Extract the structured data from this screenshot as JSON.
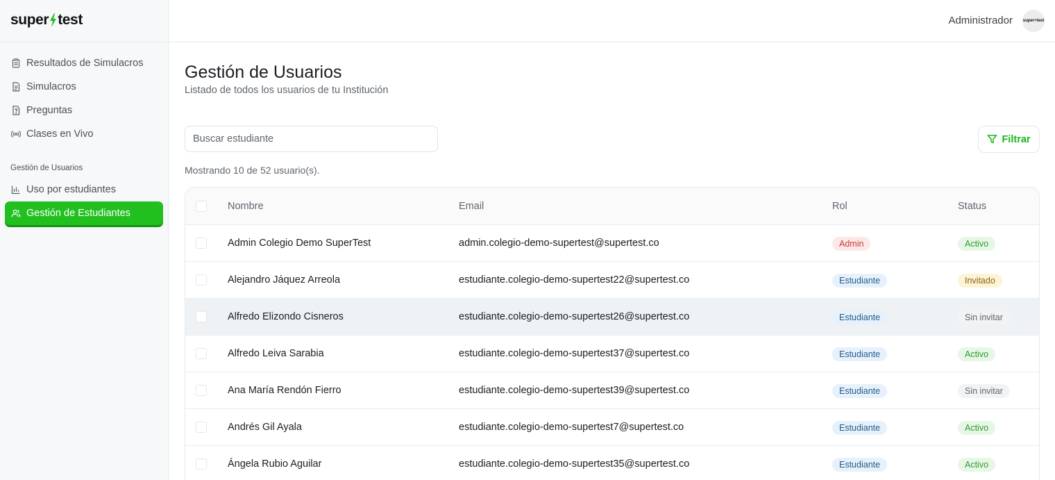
{
  "brand": {
    "logo_text_1": "super",
    "logo_text_2": "test",
    "avatar_text": "super+test"
  },
  "sidebar": {
    "items": [
      {
        "label": "Resultados de Simulacros",
        "icon": "clipboard-icon"
      },
      {
        "label": "Simulacros",
        "icon": "document-icon"
      },
      {
        "label": "Preguntas",
        "icon": "question-file-icon"
      },
      {
        "label": "Clases en Vivo",
        "icon": "broadcast-icon"
      }
    ],
    "section_label": "Gestión de Usuarios",
    "section_items": [
      {
        "label": "Uso por estudiantes",
        "icon": "bar-chart-icon"
      },
      {
        "label": "Gestión de Estudiantes",
        "icon": "users-icon",
        "active": true
      }
    ]
  },
  "header": {
    "user_name": "Administrador"
  },
  "page": {
    "title": "Gestión de Usuarios",
    "subtitle": "Listado de todos los usuarios de tu Institución",
    "search_placeholder": "Buscar estudiante",
    "filter_label": "Filtrar",
    "count_text": "Mostrando 10 de 52 usuario(s)."
  },
  "table": {
    "headers": {
      "name": "Nombre",
      "email": "Email",
      "role": "Rol",
      "status": "Status"
    },
    "rows": [
      {
        "name": "Admin Colegio Demo SuperTest",
        "email": "admin.colegio-demo-supertest@supertest.co",
        "role": "Admin",
        "status": "Activo"
      },
      {
        "name": "Alejandro Jáquez Arreola",
        "email": "estudiante.colegio-demo-supertest22@supertest.co",
        "role": "Estudiante",
        "status": "Invitado"
      },
      {
        "name": "Alfredo Elizondo Cisneros",
        "email": "estudiante.colegio-demo-supertest26@supertest.co",
        "role": "Estudiante",
        "status": "Sin invitar"
      },
      {
        "name": "Alfredo Leiva Sarabia",
        "email": "estudiante.colegio-demo-supertest37@supertest.co",
        "role": "Estudiante",
        "status": "Activo"
      },
      {
        "name": "Ana María Rendón Fierro",
        "email": "estudiante.colegio-demo-supertest39@supertest.co",
        "role": "Estudiante",
        "status": "Sin invitar"
      },
      {
        "name": "Andrés Gil Ayala",
        "email": "estudiante.colegio-demo-supertest7@supertest.co",
        "role": "Estudiante",
        "status": "Activo"
      },
      {
        "name": "Ángela Rubio Aguilar",
        "email": "estudiante.colegio-demo-supertest35@supertest.co",
        "role": "Estudiante",
        "status": "Activo"
      }
    ]
  },
  "colors": {
    "accent": "#22c01f",
    "filter_text": "#1bb51a"
  }
}
